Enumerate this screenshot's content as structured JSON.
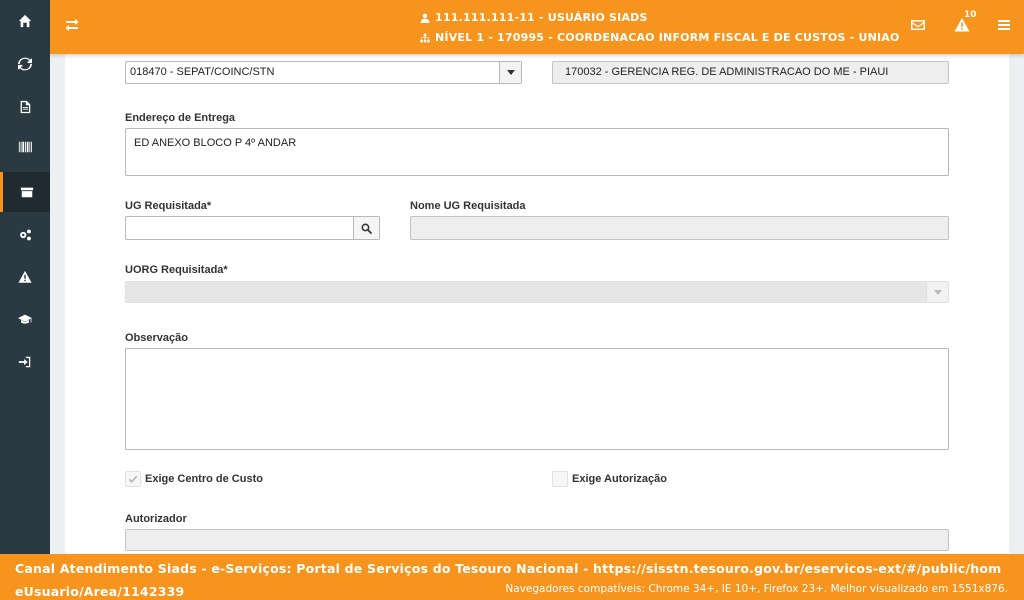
{
  "header": {
    "user_line": "111.111.111-11 - USUÁRIO SIADS",
    "level_line": "NÍVEL 1 - 170995 - COORDENACAO INFORM FISCAL E DE CUSTOS - UNIAO",
    "alerts_count": "10",
    "icons": [
      "exchange-icon",
      "user-icon",
      "sitemap-icon",
      "envelope-icon",
      "warning-icon",
      "menu-icon"
    ]
  },
  "sidebar": {
    "items": [
      {
        "icon": "home-icon"
      },
      {
        "icon": "refresh-icon"
      },
      {
        "icon": "file-icon"
      },
      {
        "icon": "barcode-icon"
      },
      {
        "icon": "archive-icon",
        "active": true
      },
      {
        "icon": "gears-icon"
      },
      {
        "icon": "warning-icon"
      },
      {
        "icon": "graduation-cap-icon"
      },
      {
        "icon": "sign-in-icon"
      }
    ]
  },
  "form": {
    "origin_select_value": "018470 - SEPAT/COINC/STN",
    "origin_ug_value": "170032 - GERENCIA REG. DE ADMINISTRACAO DO ME - PIAUI",
    "delivery_address_label": "Endereço de Entrega",
    "delivery_address_value": "ED ANEXO BLOCO P 4º ANDAR",
    "ug_requested_label": "UG Requisitada*",
    "ug_requested_value": "",
    "ug_requested_name_label": "Nome UG Requisitada",
    "ug_requested_name_value": "",
    "uorg_requested_label": "UORG Requisitada*",
    "uorg_requested_value": "",
    "observation_label": "Observação",
    "observation_value": "",
    "require_cost_center_label": "Exige Centro de Custo",
    "require_cost_center_checked": true,
    "require_authorization_label": "Exige Autorização",
    "require_authorization_checked": false,
    "authorizer_label": "Autorizador",
    "authorizer_value": ""
  },
  "footer": {
    "main_text": "Canal Atendimento Siads - e-Serviços: Portal de Serviços do Tesouro Nacional - https://sisstn.tesouro.gov.br/eservicos-ext/#/public/homeUsuario/Area/1142339",
    "compat_text": "Navegadores compatíveis: Chrome 34+, IE 10+, Firefox 23+. Melhor visualizado em 1551x876."
  },
  "colors": {
    "accent": "#f7941d",
    "sidebar": "#2b3a42",
    "sidebar_active": "#1f2b31"
  }
}
